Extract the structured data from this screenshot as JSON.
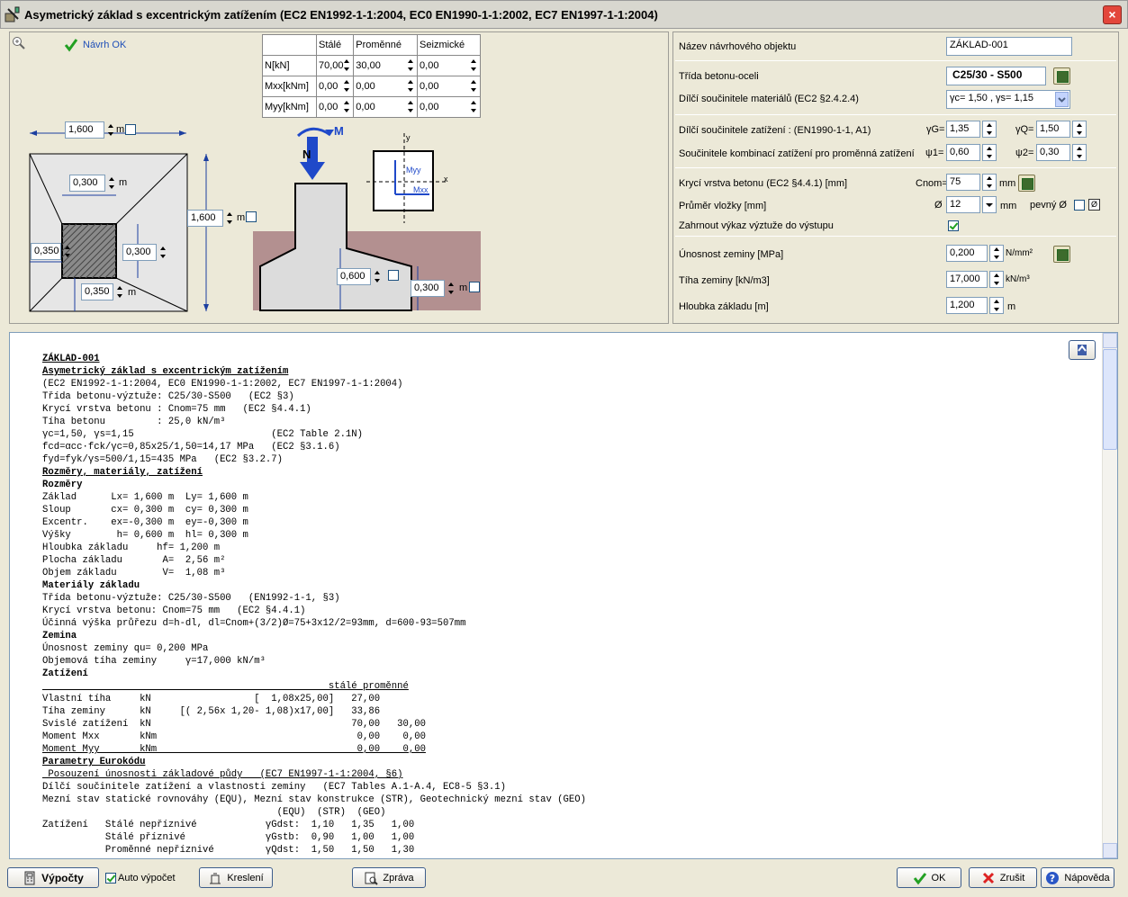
{
  "window": {
    "title": "Asymetrický základ s excentrickým zatížením (EC2 EN1992-1-1:2004, EC0 EN1990-1-1:2002, EC7 EN1997-1-1:2004)",
    "close_label": "×"
  },
  "top": {
    "navrh_ok": "Návrh OK",
    "load_table": {
      "headers": [
        "",
        "Stálé",
        "Proměnné",
        "Seizmické"
      ],
      "rows": [
        {
          "label": "N[kN]",
          "values": [
            "70,00",
            "30,00",
            "0,00"
          ]
        },
        {
          "label": "Mxx[kNm]",
          "values": [
            "0,00",
            "0,00",
            "0,00"
          ]
        },
        {
          "label": "Myy[kNm]",
          "values": [
            "0,00",
            "0,00",
            "0,00"
          ]
        }
      ]
    },
    "dims": {
      "lx": "1,600",
      "col_x": "0,300",
      "ly": "1,600",
      "ex": "0,350",
      "cy": "0,300",
      "ey": "0,350",
      "h": "0,600",
      "hl": "0,300",
      "unit": "m"
    },
    "diagram": {
      "n": "N",
      "m": "M",
      "myy": "Myy",
      "mxx": "Mxx",
      "x": "x",
      "y": "y"
    }
  },
  "right": {
    "name_label": "Název návrhového objektu",
    "name_value": "ZÁKLAD-001",
    "concrete_label": "Třída betonu-oceli",
    "concrete_value": "C25/30 - S500",
    "mat_factors_label": "Dílčí součinitele materiálů (EC2 §2.4.2.4)",
    "mat_factors_value": "γc= 1,50 , γs= 1,15",
    "load_factors_label": "Dílčí součinitele zatížení   : (EN1990-1-1, A1)",
    "gG_label": "γG=",
    "gG_value": "1,35",
    "gQ_label": "γQ=",
    "gQ_value": "1,50",
    "combo_label": "Součinitele kombinací zatížení pro proměnná zatížení",
    "psi1_label": "ψ1=",
    "psi1_value": "0,60",
    "psi2_label": "ψ2=",
    "psi2_value": "0,30",
    "cover_label": "Krycí vrstva betonu (EC2 §4.4.1) [mm]",
    "cnom_label": "Cnom=",
    "cnom_value": "75",
    "mm": "mm",
    "bar_label": "Průměr vložky [mm]",
    "phi": "Ø",
    "bar_value": "12",
    "fixed_label": "pevný Ø",
    "rebar_report_label": "Zahrnout výkaz výztuže do výstupu",
    "soil_cap_label": "Únosnost zeminy [MPa]",
    "soil_cap_value": "0,200",
    "soil_cap_unit": "N/mm²",
    "soil_weight_label": "Tíha zeminy [kN/m3]",
    "soil_weight_value": "17,000",
    "soil_weight_unit": "kN/m³",
    "depth_label": "Hloubka základu [m]",
    "depth_value": "1,200",
    "depth_unit": "m"
  },
  "bottom": {
    "calc": "Výpočty",
    "auto": "Auto výpočet",
    "draw": "Kreslení",
    "report": "Zpráva",
    "ok": "OK",
    "cancel": "Zrušit",
    "help": "Nápověda"
  },
  "report_lines": [
    {
      "t": "ZÁKLAD-001",
      "s": "bu"
    },
    {
      "t": "Asymetrický základ s excentrickým zatížením",
      "s": "bu"
    },
    {
      "t": "(EC2 EN1992-1-1:2004, EC0 EN1990-1-1:2002, EC7 EN1997-1-1:2004)",
      "s": ""
    },
    {
      "t": "Třída betonu-výztuže: C25/30-S500   (EC2 §3)",
      "s": ""
    },
    {
      "t": "Krycí vrstva betonu : Cnom=75 mm   (EC2 §4.4.1)",
      "s": ""
    },
    {
      "t": "Tíha betonu         : 25,0 kN/m³",
      "s": ""
    },
    {
      "t": "γc=1,50, γs=1,15                        (EC2 Table 2.1N)",
      "s": ""
    },
    {
      "t": "fcd=αcc·fck/γc=0,85x25/1,50=14,17 MPa   (EC2 §3.1.6)",
      "s": ""
    },
    {
      "t": "fyd=fyk/γs=500/1,15=435 MPa   (EC2 §3.2.7)",
      "s": ""
    },
    {
      "t": "Rozměry, materiály, zatížení",
      "s": "bu"
    },
    {
      "t": "Rozměry",
      "s": "b"
    },
    {
      "t": "Základ      Lx= 1,600 m  Ly= 1,600 m",
      "s": ""
    },
    {
      "t": "Sloup       cx= 0,300 m  cy= 0,300 m",
      "s": ""
    },
    {
      "t": "Excentr.    ex=-0,300 m  ey=-0,300 m",
      "s": ""
    },
    {
      "t": "Výšky        h= 0,600 m  hl= 0,300 m",
      "s": ""
    },
    {
      "t": "Hloubka základu     hf= 1,200 m",
      "s": ""
    },
    {
      "t": "Plocha základu       A=  2,56 m²",
      "s": ""
    },
    {
      "t": "Objem základu        V=  1,08 m³",
      "s": ""
    },
    {
      "t": "Materiály základu",
      "s": "b"
    },
    {
      "t": "Třída betonu-výztuže: C25/30-S500   (EN1992-1-1, §3)",
      "s": ""
    },
    {
      "t": "Krycí vrstva betonu: Cnom=75 mm   (EC2 §4.4.1)",
      "s": ""
    },
    {
      "t": "Účinná výška průřezu d=h-dl, dl=Cnom+(3/2)Ø=75+3x12/2=93mm, d=600-93=507mm",
      "s": ""
    },
    {
      "t": "Zemina",
      "s": "b"
    },
    {
      "t": "Únosnost zeminy qu= 0,200 MPa",
      "s": ""
    },
    {
      "t": "Objemová tíha zeminy     γ=17,000 kN/m³",
      "s": ""
    },
    {
      "t": "Zatížení",
      "s": "b"
    },
    {
      "t": "                                                  stálé proměnné",
      "s": "u"
    },
    {
      "t": "Vlastní tíha     kN                  [  1,08x25,00]   27,00",
      "s": ""
    },
    {
      "t": "Tíha zeminy      kN     [( 2,56x 1,20- 1,08)x17,00]   33,86",
      "s": ""
    },
    {
      "t": "Svislé zatížení  kN                                   70,00   30,00",
      "s": ""
    },
    {
      "t": "Moment Mxx       kNm                                   0,00    0,00",
      "s": ""
    },
    {
      "t": "Moment Myy       kNm                                   0,00    0,00",
      "s": "u"
    },
    {
      "t": "Parametry Eurokódu",
      "s": "bu"
    },
    {
      "t": " Posouzení únosnosti základové půdy   (EC7 EN1997-1-1:2004, §6)",
      "s": "u"
    },
    {
      "t": "Dílčí součinitele zatížení a vlastnosti zeminy   (EC7 Tables A.1-A.4, EC8-5 §3.1)",
      "s": ""
    },
    {
      "t": "Mezní stav statické rovnováhy (EQU), Mezní stav konstrukce (STR), Geotechnický mezní stav (GEO)",
      "s": ""
    },
    {
      "t": "                                         (EQU)  (STR)  (GEO)",
      "s": ""
    },
    {
      "t": "Zatížení   Stálé nepříznivé            γGdst:  1,10   1,35   1,00",
      "s": ""
    },
    {
      "t": "           Stálé příznivé              γGstb:  0,90   1,00   1,00",
      "s": ""
    },
    {
      "t": "           Proměnné nepříznivé         γQdst:  1,50   1,50   1,30",
      "s": ""
    }
  ]
}
